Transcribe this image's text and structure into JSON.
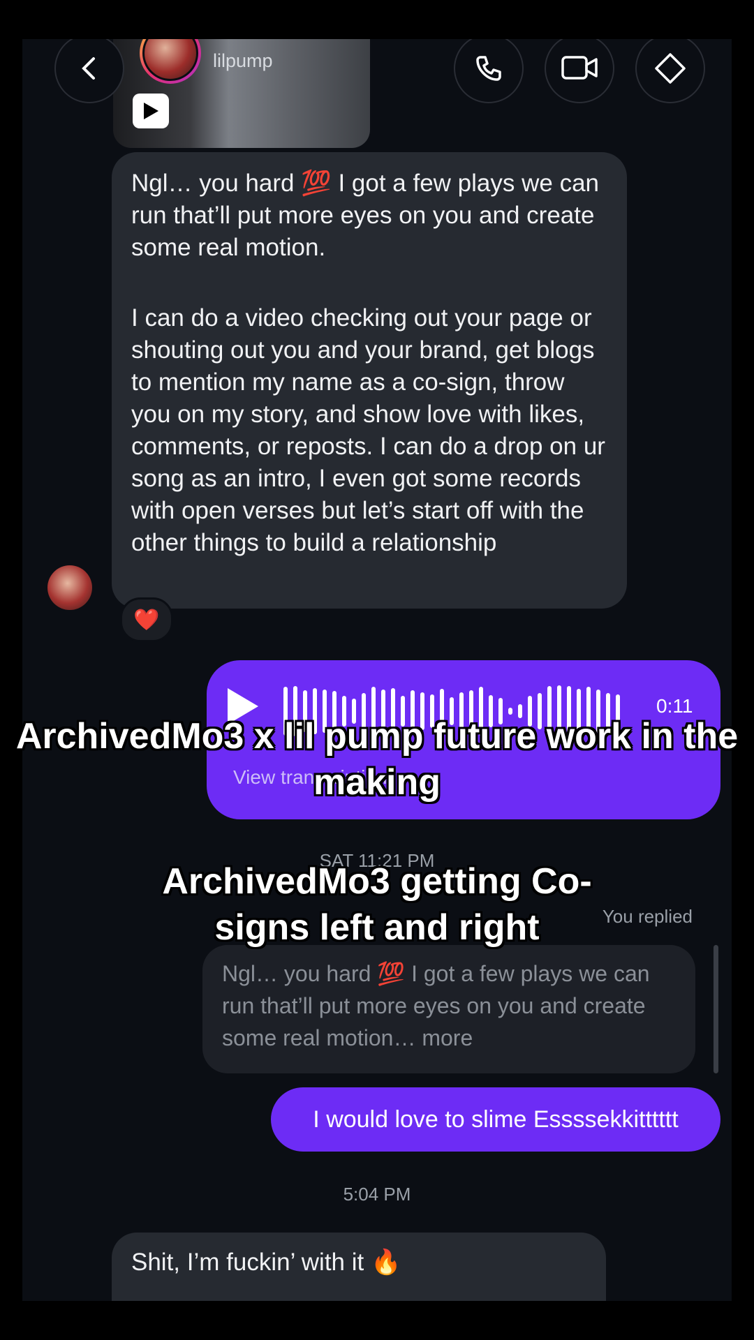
{
  "header": {
    "username": "lilpump",
    "back_icon": "chevron-left-icon",
    "call_icon": "phone-icon",
    "video_icon": "video-camera-icon",
    "info_icon": "tag-icon"
  },
  "messages": {
    "incoming_1": {
      "paragraph_1": "Ngl… you hard 💯 I got a few plays we can run that’ll put more eyes on you and create some real motion.",
      "paragraph_2": "I can do a video checking out your page or shouting out you and your brand, get blogs to mention my name as a co-sign, throw you on my story, and show love with likes, comments, or reposts. I can do a drop on ur song as an intro, I even got some records with open verses but let’s start off with the other things to build a relationship",
      "reaction": "❤️"
    },
    "voice_note": {
      "duration": "0:11",
      "transcript_label": "View transcription"
    },
    "timestamp_1": "SAT 11:21 PM",
    "you_replied": "You replied",
    "quoted_text": "Ngl… you hard 💯 I got a few plays we can run that’ll put more eyes on you and create some real motion…",
    "quoted_more": " more",
    "outgoing_1": "I would love to slime Essssekkitttttt",
    "timestamp_2": "5:04 PM",
    "incoming_2": "Shit, I’m fuckin’ with it 🔥"
  },
  "captions": {
    "line_1": "ArchivedMo3 x lil pump future work in the making",
    "line_2": "ArchivedMo3 getting Co-signs left and right"
  },
  "colors": {
    "background": "#0b0e14",
    "incoming_bubble": "#262a31",
    "outgoing_bubble": "#6d2cf5"
  }
}
